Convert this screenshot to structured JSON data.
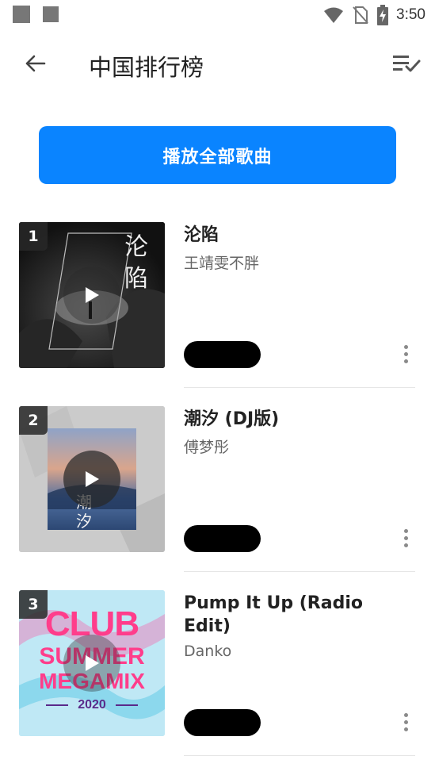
{
  "status_bar": {
    "time": "3:50",
    "icons": [
      "notification-square-icon",
      "notification-square-icon",
      "wifi-icon",
      "no-sim-icon",
      "battery-charging-icon"
    ]
  },
  "app_bar": {
    "title": "中国排行榜",
    "back_icon": "arrow-left-icon",
    "sort_icon": "playlist-check-icon"
  },
  "play_all_label": "播放全部歌曲",
  "songs": [
    {
      "rank": "1",
      "title": "沦陷",
      "artist": "王靖雯不胖",
      "cover_text": "沦陷"
    },
    {
      "rank": "2",
      "title": "潮汐 (DJ版)",
      "artist": "傅梦彤"
    },
    {
      "rank": "3",
      "title": "Pump It Up (Radio Edit)",
      "artist": "Danko",
      "cover_text": [
        "CLUB",
        "SUMMER",
        "MEGAMIX",
        "2020"
      ]
    }
  ],
  "colors": {
    "accent": "#0a84ff",
    "title_text": "#222222",
    "secondary_text": "#666666"
  }
}
